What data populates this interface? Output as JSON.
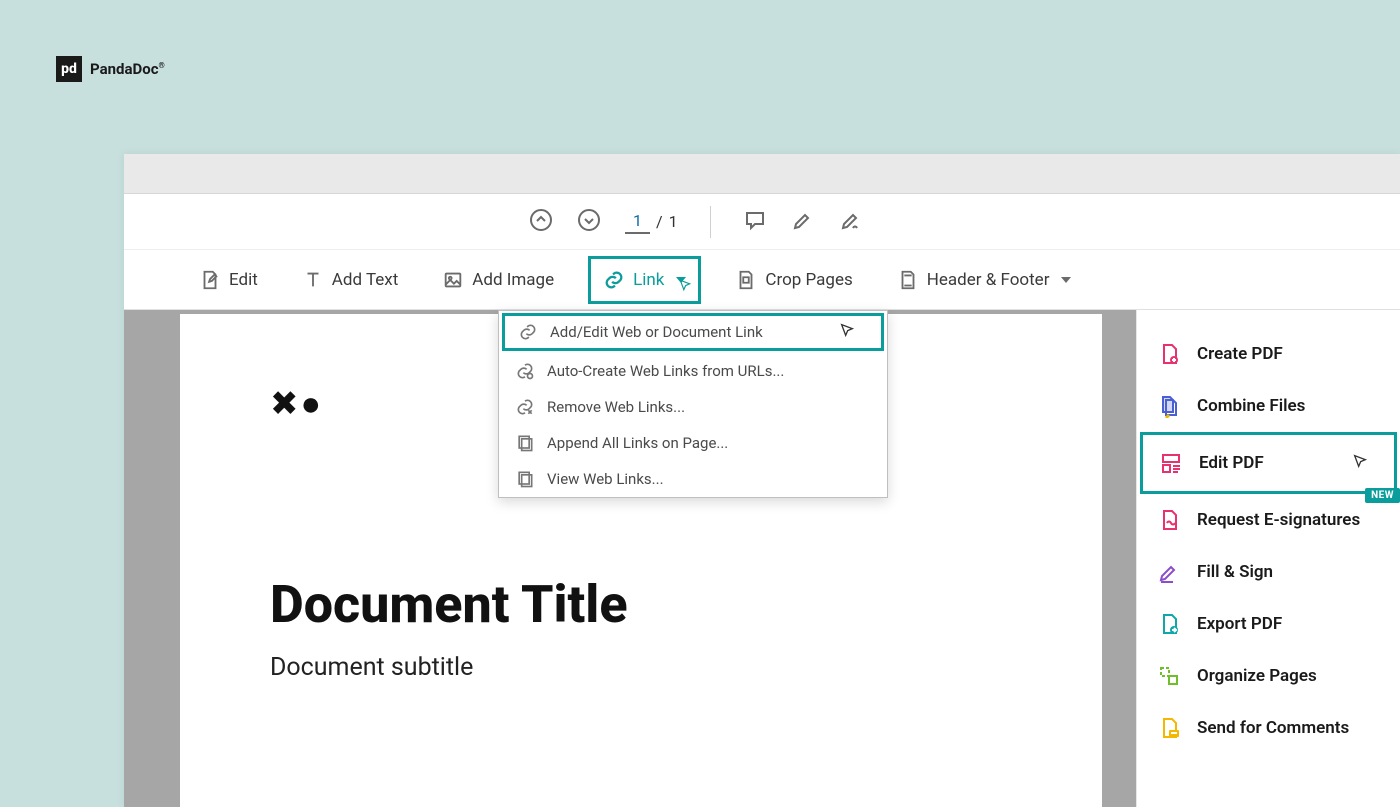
{
  "brand": {
    "name": "PandaDoc",
    "mark": "pd"
  },
  "topToolbar": {
    "currentPage": "1",
    "separator": "/",
    "totalPages": "1"
  },
  "editToolbar": {
    "edit": "Edit",
    "addText": "Add Text",
    "addImage": "Add Image",
    "link": "Link",
    "cropPages": "Crop Pages",
    "headerFooter": "Header & Footer"
  },
  "linkMenu": {
    "items": [
      "Add/Edit Web or Document Link",
      "Auto-Create Web Links from URLs...",
      "Remove Web Links...",
      "Append All Links on Page...",
      "View Web Links..."
    ]
  },
  "document": {
    "title": "Document Title",
    "subtitle": "Document subtitle"
  },
  "rightPanel": {
    "newBadge": "NEW",
    "items": [
      {
        "label": "Create PDF",
        "color": "#e8326e"
      },
      {
        "label": "Combine Files",
        "color": "#4a5fd1"
      },
      {
        "label": "Edit PDF",
        "color": "#e8326e",
        "highlighted": true
      },
      {
        "label": "Request E-signatures",
        "color": "#e8326e",
        "badge": true
      },
      {
        "label": "Fill & Sign",
        "color": "#8b4dc9"
      },
      {
        "label": "Export PDF",
        "color": "#0ea8a8"
      },
      {
        "label": "Organize Pages",
        "color": "#6fbf2d"
      },
      {
        "label": "Send for Comments",
        "color": "#f5b800"
      }
    ]
  }
}
